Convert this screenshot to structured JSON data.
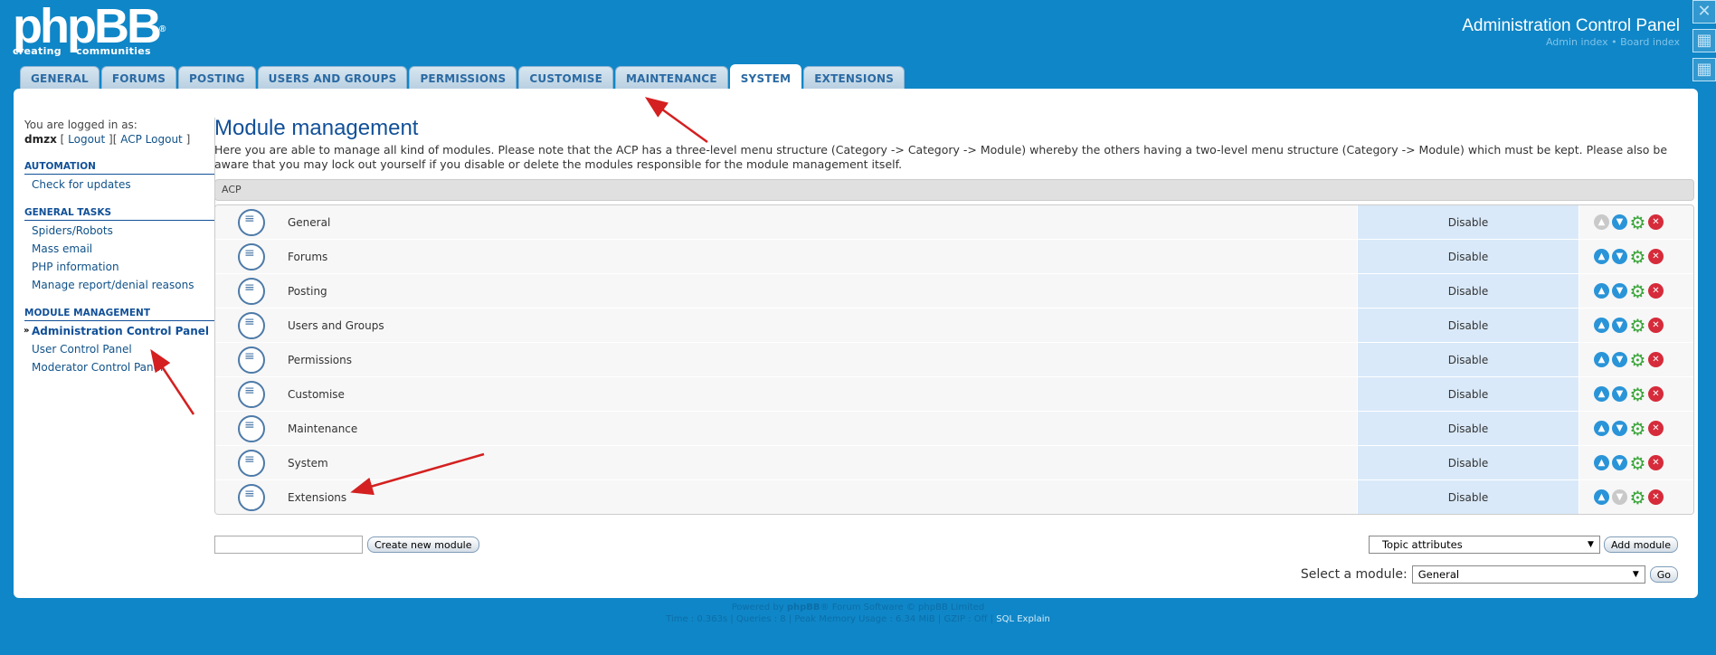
{
  "header": {
    "logo_text": "phpBB",
    "logo_reg": "®",
    "logo_tagline": "creating communities",
    "title": "Administration Control Panel",
    "links": "Admin index • Board index"
  },
  "tabs": [
    {
      "label": "GENERAL"
    },
    {
      "label": "FORUMS"
    },
    {
      "label": "POSTING"
    },
    {
      "label": "USERS AND GROUPS"
    },
    {
      "label": "PERMISSIONS"
    },
    {
      "label": "CUSTOMISE"
    },
    {
      "label": "MAINTENANCE"
    },
    {
      "label": "SYSTEM",
      "active": true
    },
    {
      "label": "EXTENSIONS"
    }
  ],
  "sidebar": {
    "logged_in_label": "You are logged in as:",
    "username": "dmzx",
    "logout": "Logout",
    "acp_logout": "ACP Logout",
    "sections": [
      {
        "title": "AUTOMATION",
        "items": [
          "Check for updates"
        ]
      },
      {
        "title": "GENERAL TASKS",
        "items": [
          "Spiders/Robots",
          "Mass email",
          "PHP information",
          "Manage report/denial reasons"
        ]
      },
      {
        "title": "MODULE MANAGEMENT",
        "items": [
          "Administration Control Panel",
          "User Control Panel",
          "Moderator Control Panel"
        ]
      }
    ]
  },
  "main": {
    "title": "Module management",
    "description": "Here you are able to manage all kind of modules. Please note that the ACP has a three-level menu structure (Category -> Category -> Module) whereby the others having a two-level menu structure (Category -> Module) which must be kept. Please also be aware that you may lock out yourself if you disable or delete the modules responsible for the module management itself.",
    "table_header": "ACP",
    "modules": [
      {
        "name": "General",
        "status": "Disable",
        "up_enabled": false,
        "down_enabled": true
      },
      {
        "name": "Forums",
        "status": "Disable",
        "up_enabled": true,
        "down_enabled": true
      },
      {
        "name": "Posting",
        "status": "Disable",
        "up_enabled": true,
        "down_enabled": true
      },
      {
        "name": "Users and Groups",
        "status": "Disable",
        "up_enabled": true,
        "down_enabled": true
      },
      {
        "name": "Permissions",
        "status": "Disable",
        "up_enabled": true,
        "down_enabled": true
      },
      {
        "name": "Customise",
        "status": "Disable",
        "up_enabled": true,
        "down_enabled": true
      },
      {
        "name": "Maintenance",
        "status": "Disable",
        "up_enabled": true,
        "down_enabled": true
      },
      {
        "name": "System",
        "status": "Disable",
        "up_enabled": true,
        "down_enabled": true
      },
      {
        "name": "Extensions",
        "status": "Disable",
        "up_enabled": true,
        "down_enabled": false
      }
    ],
    "create_module_value": "",
    "create_module_button": "Create new module",
    "add_module_select": "Topic attributes",
    "add_module_button": "Add module",
    "select_module_label": "Select a module:",
    "select_module_value": "General",
    "go_button": "Go"
  },
  "footer": {
    "line1_prefix": "Powered by",
    "line1_brand": "phpBB",
    "line1_suffix": "® Forum Software © phpBB Limited",
    "line2_stats": "Time : 0.363s | Queries : 8 | Peak Memory Usage : 6.34 MiB | GZIP : Off |",
    "line2_link": "SQL Explain"
  },
  "colors": {
    "background": "#0f86c7",
    "accent": "#115098",
    "annotation_arrow": "#d42020"
  }
}
